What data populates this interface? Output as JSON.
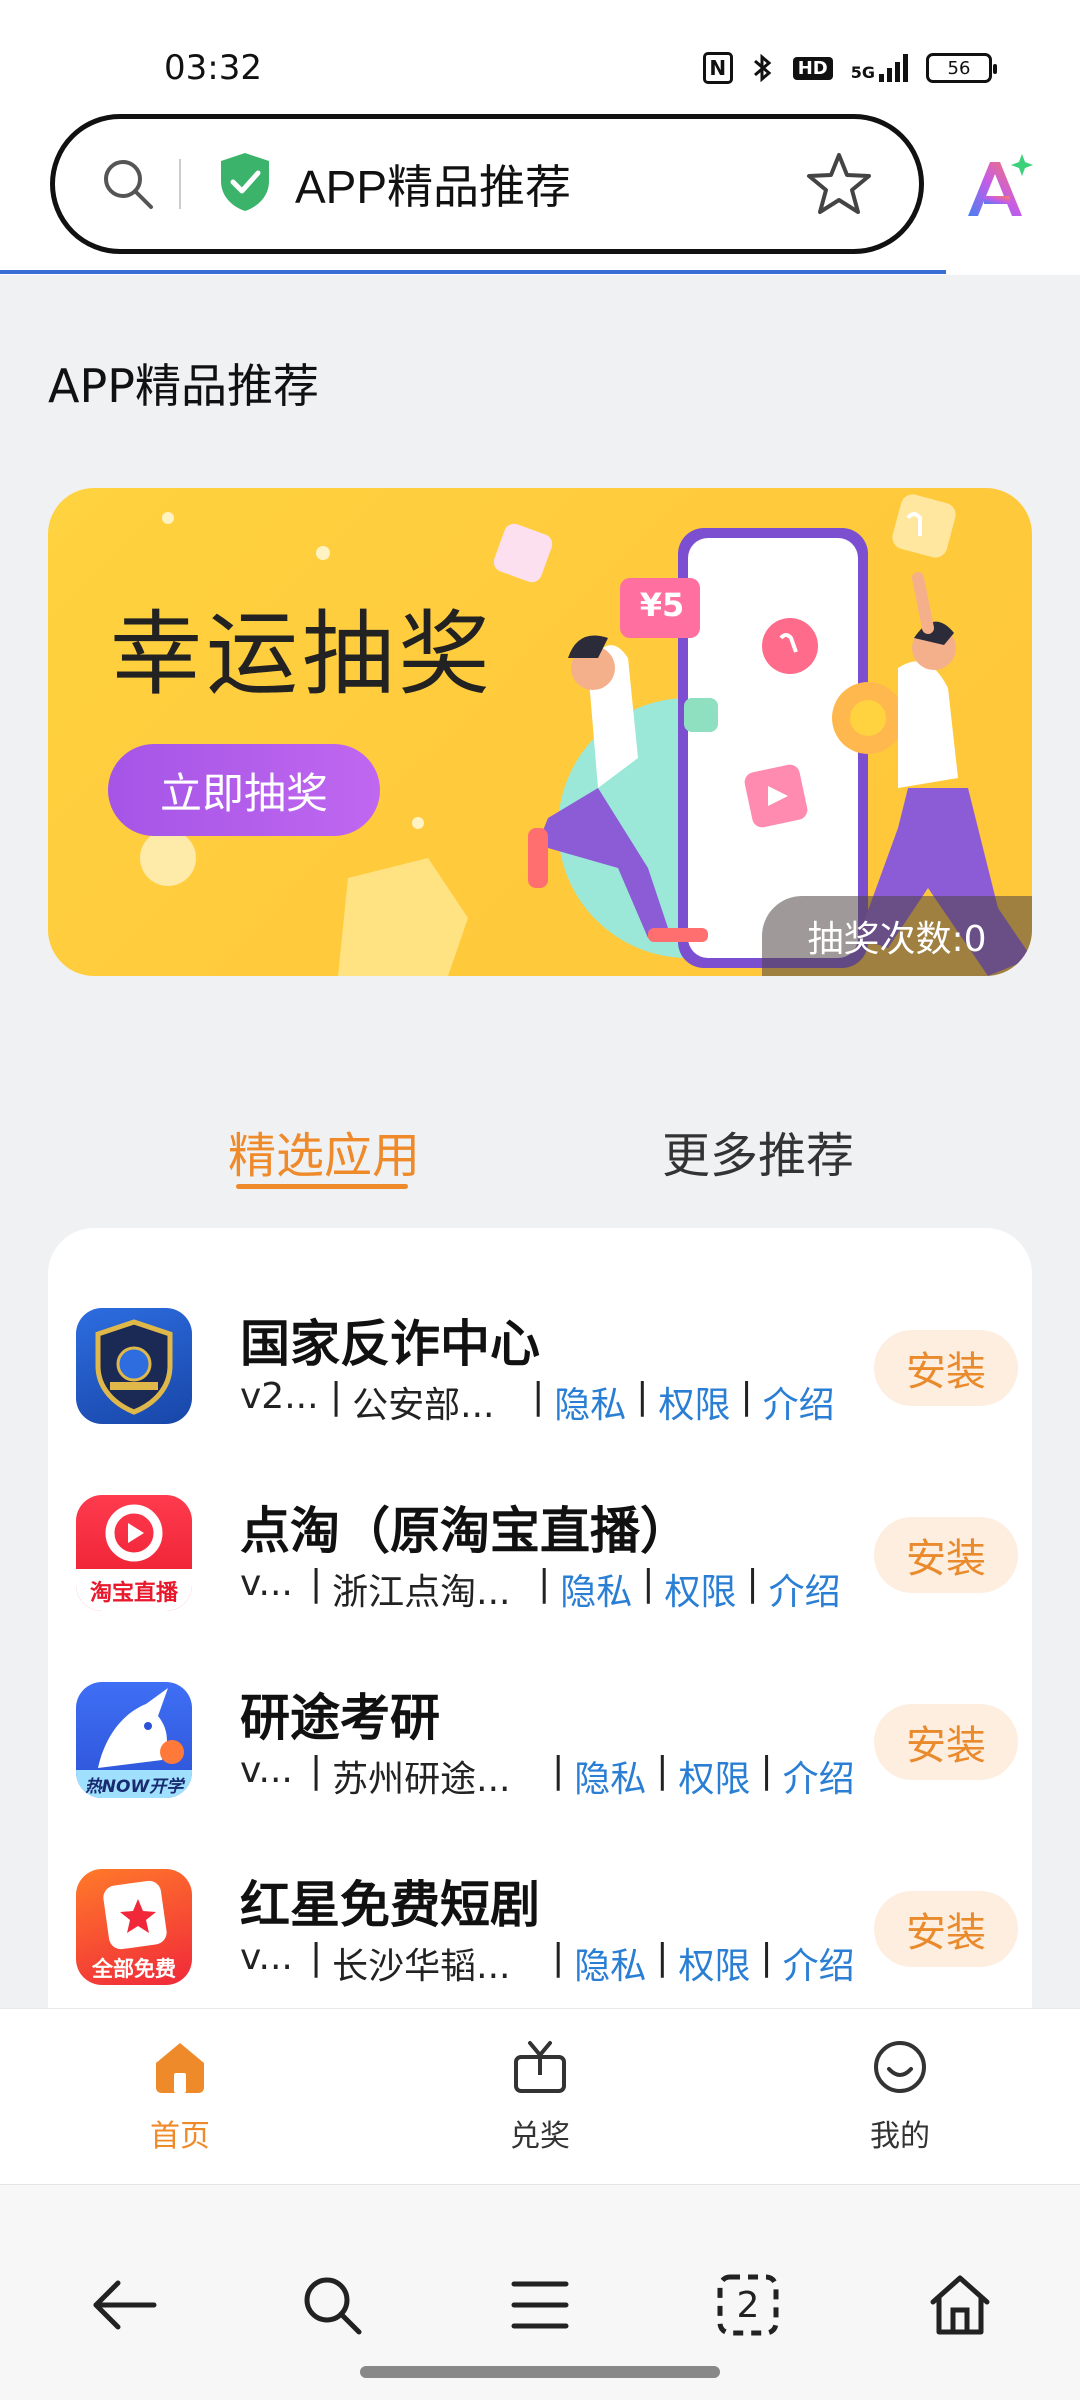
{
  "status_bar": {
    "time": "03:32",
    "network": "5G",
    "hd": "HD",
    "battery": "56",
    "icons": [
      "nfc-icon",
      "bluetooth-icon",
      "hd-icon",
      "signal-5g-icon",
      "battery-icon"
    ]
  },
  "address_bar": {
    "title": "APP精品推荐",
    "icons": [
      "search-icon",
      "shield-check-icon",
      "star-icon",
      "ai-assistant-icon"
    ]
  },
  "page": {
    "section_title": "APP精品推荐"
  },
  "banner": {
    "title": "幸运抽奖",
    "button_label": "立即抽奖",
    "count_label": "抽奖次数:0",
    "coupon_text": "¥5"
  },
  "tabs": [
    {
      "label": "精选应用",
      "selected": true
    },
    {
      "label": "更多推荐",
      "selected": false
    }
  ],
  "apps": [
    {
      "name": "国家反诈中心",
      "version": "v2...",
      "developer": "公安部...",
      "privacy": "隐私",
      "permissions": "权限",
      "intro": "介绍",
      "install": "安装",
      "icon": "anti-fraud-shield-icon"
    },
    {
      "name": "点淘（原淘宝直播）",
      "version": "v...",
      "developer": "浙江点淘...",
      "privacy": "隐私",
      "permissions": "权限",
      "intro": "介绍",
      "install": "安装",
      "icon": "diantao-icon",
      "icon_label": "淘宝直播"
    },
    {
      "name": "研途考研",
      "version": "v...",
      "developer": "苏州研途...",
      "privacy": "隐私",
      "permissions": "权限",
      "intro": "介绍",
      "install": "安装",
      "icon": "unicorn-icon",
      "icon_label": "热NOW开学"
    },
    {
      "name": "红星免费短剧",
      "version": "v...",
      "developer": "长沙华韬...",
      "privacy": "隐私",
      "permissions": "权限",
      "intro": "介绍",
      "install": "安装",
      "icon": "red-star-play-icon",
      "icon_label": "全部免费"
    }
  ],
  "app_nav": [
    {
      "label": "首页",
      "icon": "home-icon",
      "active": true
    },
    {
      "label": "兑奖",
      "icon": "tv-gift-icon",
      "active": false
    },
    {
      "label": "我的",
      "icon": "smile-icon",
      "active": false
    }
  ],
  "browser_toolbar": {
    "tab_count": "2",
    "icons": [
      "back-arrow-icon",
      "search-icon",
      "menu-icon",
      "tabs-icon",
      "home-icon"
    ]
  },
  "colors": {
    "accent": "#ef8a2a",
    "link": "#2a7fd4",
    "banner_bg": "#ffc93c",
    "banner_button": "#b05ee8",
    "progress": "#3a6fd8"
  }
}
